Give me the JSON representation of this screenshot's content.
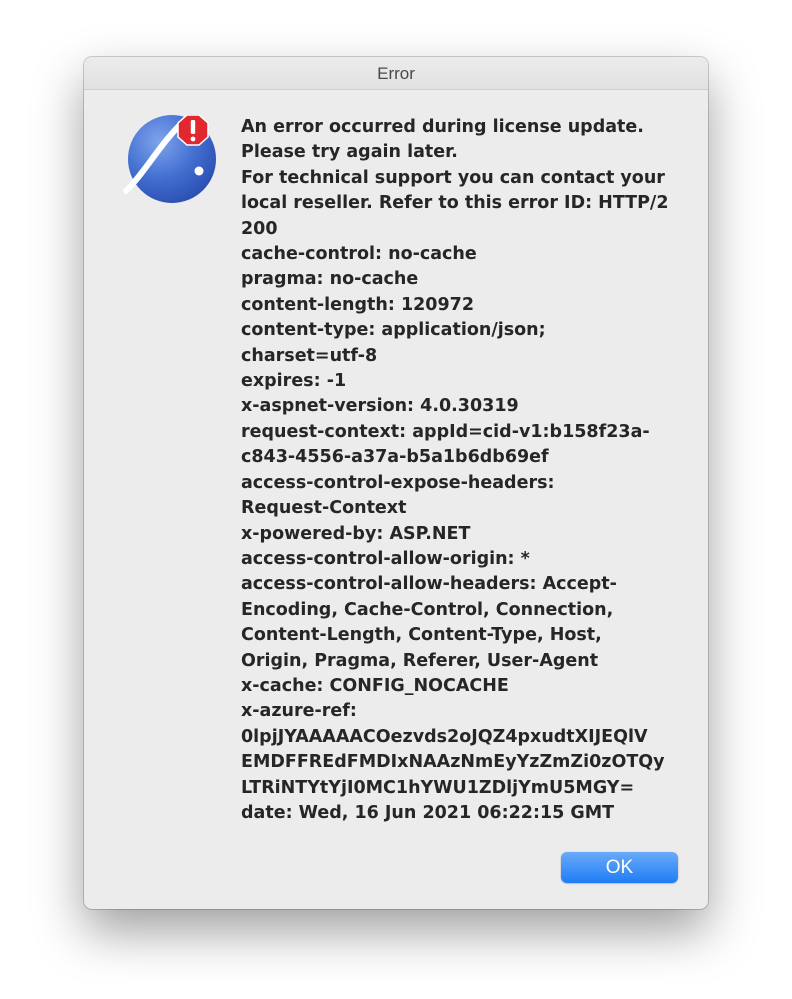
{
  "window": {
    "title": "Error"
  },
  "dialog": {
    "icon": "app-icon-with-warning-badge",
    "badge_icon": "exclamation-icon",
    "message_lines": [
      "An error occurred during license update.",
      "Please try again later.",
      "For technical support you can contact your",
      "local reseller. Refer to this error ID: HTTP/2",
      "200",
      "cache-control: no-cache",
      "pragma: no-cache",
      "content-length: 120972",
      "content-type: application/json;",
      "charset=utf-8",
      "expires: -1",
      "x-aspnet-version: 4.0.30319",
      "request-context: appId=cid-v1:b158f23a-",
      "c843-4556-a37a-b5a1b6db69ef",
      "access-control-expose-headers:",
      "Request-Context",
      "x-powered-by: ASP.NET",
      "access-control-allow-origin: *",
      "access-control-allow-headers: Accept-",
      "Encoding, Cache-Control, Connection,",
      "Content-Length, Content-Type, Host,",
      "Origin, Pragma, Referer, User-Agent",
      "x-cache: CONFIG_NOCACHE",
      "x-azure-ref:",
      "0lpjJYAAAAACOezvds2oJQZ4pxudtXIJEQlV",
      "EMDFFREdFMDIxNAAzNmEyYzZmZi0zOTQy",
      "LTRiNTYtYjI0MC1hYWU1ZDljYmU5MGY=",
      "date: Wed, 16 Jun 2021 06:22:15 GMT"
    ],
    "ok_label": "OK"
  },
  "colors": {
    "window_bg": "#ececec",
    "button_accent": "#1f7df5",
    "warning_badge": "#e0282e",
    "icon_blue": "#3d68c9"
  }
}
